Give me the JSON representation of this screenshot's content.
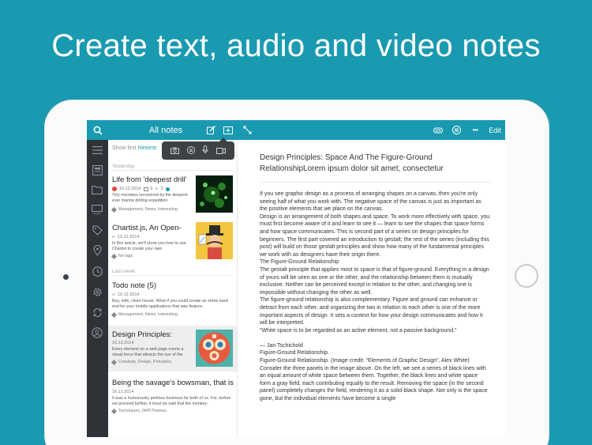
{
  "headline": "Create text, audio and video notes",
  "topbar": {
    "title": "All notes",
    "edit_label": "Edit",
    "more_label": "•••"
  },
  "list": {
    "show_first_label": "Show first",
    "show_first_value": "Newest",
    "section_yesterday": "Yesterday",
    "section_last_week": "Last week",
    "notes": [
      {
        "title": "Life from 'deepest drill'",
        "date": "16.12.2014",
        "attachments": "6",
        "links": "3",
        "body": "Tiny microbes uncovered by the deepest-ever marine drilling expedition",
        "tags": "Management, News, Interesting"
      },
      {
        "title": "Chartist.js, An Open-",
        "date": "16.12.2014",
        "body": "In this article, we'll show you how to use Chartist to create your own",
        "tags": "No tags"
      },
      {
        "title": "Todo note (5)",
        "date": "16.12.2014",
        "body": "Buy, milk, clean house,  What if you could create an entire back end for your mobile applications that was feature-",
        "tags": "Management, News, Interesting"
      },
      {
        "title": "Design Principles:",
        "date": "16.12.2014",
        "body": "Every element on a web page exerts a visual force that attracts the eye of the",
        "tags": "Creativity, Design, Principles,"
      },
      {
        "title": "Being the savage's bowsman, that is,",
        "date": "16.12.2014",
        "body": "It was a humorously perilous business for both of us. For, before we proceed further, it must be said that the monkey-",
        "tags": "Techniques, (WP)Themes"
      }
    ]
  },
  "detail": {
    "title": "Design Principles: Space And The Figure-Ground RelationshipLorem ipsum dolor sit amet, consectetur",
    "paragraphs": [
      "If you see graphic design as a process of arranging shapes on a canvas, then you're only seeing half of what you work with. The negative space of the canvas is just as important as the positive elements that we place on the canvas.",
      "Design is an arrangement of both shapes and space. To work more effectively with space, you must first become aware of it and learn to see it — learn to see the shapes that space forms and how space communicates. This is second part of a series on design principles for beginners. The first part covered an introduction to gestalt; the rest of the series (including this post) will build on those gestalt principles and show how many of the fundamental principles we work with as designers have their origin there.",
      "The Figure-Ground Relationship",
      "The gestalt principle that applies most to space is that of figure-ground. Everything in a design of yours will be seen as one or the other, and the relationship between them is mutually exclusive. Neither can be perceived except in relation to the other, and changing one is impossible without changing the other as well.",
      "The figure-ground relationship is also complementary. Figure and ground can enhance or detract from each other, and organizing the two in relation to each other is one of the more important aspects of design. It sets a context for how your design communicates and how it will be interpreted.",
      "“White space is to be regarded as an active element, not a passive background.”",
      "",
      "— Jan Tschichold",
      "Figure-Ground Relationship.",
      "Figure-Ground Relationship. (Image credit: “Elements of Graphic Design”, Alex White)",
      "Consider the three panels in the image above. On the left, we see a series of black lines with an equal amount of white space between them. Together, the black lines and white space form a gray field, each contributing equally to the result. Removing the space (in the second panel) completely changes the field, rendering it as a solid-black shape. Not only is the space gone, but the individual elements have become a single"
    ]
  },
  "colors": {
    "background": "#1a9ab0",
    "topbar": "#1a9ab0",
    "accent": "#1a9ab0",
    "sidebar": "#2f3338",
    "popover": "#3d4247",
    "flag_red": "#e0453b"
  },
  "icons": {
    "topbar": [
      "search-icon",
      "compose-icon",
      "add-note-icon",
      "expand-icon",
      "attachment-icon",
      "list-icon",
      "more-icon"
    ],
    "popover": [
      "camera-icon",
      "text-icon",
      "microphone-icon",
      "video-icon"
    ],
    "sidebar": [
      "menu-icon",
      "notes-icon",
      "folder-icon",
      "web-icon",
      "tags-icon",
      "location-icon",
      "reminder-icon",
      "settings-icon",
      "sync-icon",
      "account-icon"
    ]
  }
}
